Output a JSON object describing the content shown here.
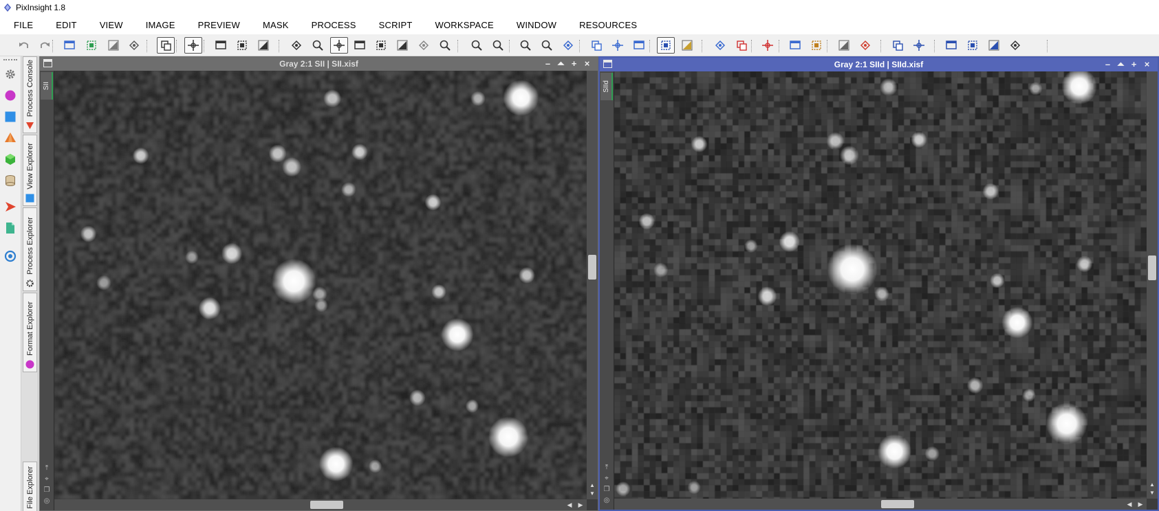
{
  "app": {
    "title": "PixInsight 1.8"
  },
  "menu": {
    "items": [
      "FILE",
      "EDIT",
      "VIEW",
      "IMAGE",
      "PREVIEW",
      "MASK",
      "PROCESS",
      "SCRIPT",
      "WORKSPACE",
      "WINDOW",
      "RESOURCES"
    ]
  },
  "toolbar": {
    "icons": [
      "undo-icon",
      "redo-icon",
      "identifier-icon",
      "new-image-icon",
      "hide-icon",
      "unhide-icon",
      "new-instance-icon",
      "clone-icon",
      "duplicate-icon",
      "view-icon",
      "mask-icon",
      "readout-icon",
      "zoom-fit-icon",
      "pan-icon",
      "center-icon",
      "preview-icon",
      "dynamic-icon",
      "select-icon",
      "zoom-in-icon",
      "zoom-out-icon",
      "zoom-1-icon",
      "zoom-2-icon",
      "zoom-fit-window-icon",
      "fit-view-icon",
      "fit-window-icon",
      "stretch-icon",
      "autostretch-icon",
      "screen-icon",
      "stf-icon",
      "channel-icon",
      "mask-show-icon",
      "mask-invert-icon",
      "preview-new-icon",
      "preview-delete-icon",
      "gray-icon",
      "color-icon",
      "rotate-left-icon",
      "rotate-right-icon",
      "rotate-180-icon",
      "mirror-h-icon",
      "mirror-v-icon",
      "crop-icon"
    ]
  },
  "explorer_tabs": [
    "Process Console",
    "View Explorer",
    "Process Explorer",
    "Format Explorer",
    "File Explorer"
  ],
  "windows": [
    {
      "title": "Gray 2:1 SII | SII.xisf",
      "tab_label": "SII",
      "active": false
    },
    {
      "title": "Gray 2:1 SIId | SIId.xisf",
      "tab_label": "SIId",
      "active": true
    }
  ],
  "window_controls": {
    "minimize": "–",
    "shade": "⏶",
    "maximize": "+",
    "close": "×"
  },
  "colors": {
    "active_titlebar": "#5566b8",
    "inactive_titlebar": "#6e6e6e",
    "tab_accent": "#2f9e52"
  }
}
